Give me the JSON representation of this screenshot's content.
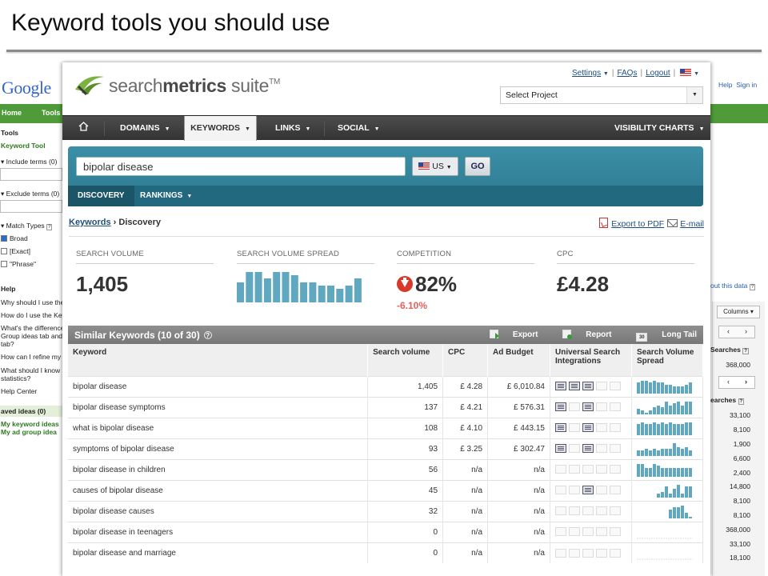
{
  "slide": {
    "title": "Keyword tools you should use"
  },
  "google_left": {
    "logo_text": "Google",
    "nav_home": "Home",
    "nav_tools": "Tools",
    "tools_heading": "Tools",
    "keyword_tool": "Keyword Tool",
    "include_terms": "Include terms (0)",
    "exclude_terms": "Exclude terms (0)",
    "match_types": "Match Types",
    "match_broad": "Broad",
    "match_exact": "[Exact]",
    "match_phrase": "\"Phrase\"",
    "help_heading": "Help",
    "help_lines": [
      "Why should I use the",
      "How do I use the Key",
      "What's the difference",
      "Group ideas tab and",
      "tab?",
      "How can I refine my i",
      "What should I know a",
      "statistics?",
      "Help Center"
    ],
    "saved_ideas": "aved ideas (0)",
    "my_keyword_ideas": "My keyword ideas",
    "my_ad_group_ideas": "My ad group idea"
  },
  "google_right": {
    "help": "Help",
    "sign_in": "Sign in",
    "about_data": "out this data",
    "columns": "Columns",
    "searches_label": "Searches",
    "searches_label2": "earches",
    "first_value": "368,000",
    "values": [
      "33,100",
      "8,100",
      "1,900",
      "6,600",
      "2,400",
      "14,800",
      "8,100",
      "8,100",
      "368,000",
      "33,100",
      "18,100"
    ]
  },
  "sm": {
    "brand_light": "search",
    "brand_bold": "metrics",
    "brand_suite": " suite",
    "brand_tm": "TM",
    "links": {
      "settings": "Settings",
      "faqs": "FAQs",
      "logout": "Logout"
    },
    "project_select": "Select Project",
    "nav": {
      "domains": "DOMAINS",
      "keywords": "KEYWORDS",
      "links": "LINKS",
      "social": "SOCIAL",
      "visibility_charts": "VISIBILITY CHARTS"
    },
    "search": {
      "value": "bipolar disease",
      "country": "US",
      "go": "GO"
    },
    "subtabs": {
      "discovery": "DISCOVERY",
      "rankings": "RANKINGS"
    },
    "breadcrumb": {
      "root": "Keywords",
      "sep": "›",
      "current": "Discovery"
    },
    "exports": {
      "pdf": "Export to PDF",
      "email": "E-mail"
    },
    "kpis": {
      "search_volume_label": "SEARCH VOLUME",
      "search_volume": "1,405",
      "spread_label": "SEARCH VOLUME SPREAD",
      "spread_values": [
        6,
        9,
        9,
        7,
        9,
        9,
        8,
        6,
        6,
        5,
        5,
        4,
        5,
        7
      ],
      "competition_label": "COMPETITION",
      "competition": "82%",
      "competition_change": "-6.10%",
      "cpc_label": "CPC",
      "cpc": "£4.28"
    },
    "similar": {
      "title": "Similar Keywords (10 of 30)",
      "export": "Export",
      "report": "Report",
      "long_tail": "Long Tail",
      "long_tail_badge": "30",
      "headers": [
        "Keyword",
        "Search volume",
        "CPC",
        "Ad Budget",
        "Universal Search Integrations",
        "Search Volume Spread"
      ],
      "rows": [
        {
          "keyword": "bipolar disease",
          "volume": "1,405",
          "cpc": "£ 4.28",
          "budget": "£ 6,010.84",
          "integrations": [
            1,
            1,
            1,
            0,
            0
          ],
          "spread": [
            6,
            7,
            7,
            6,
            7,
            6,
            6,
            5,
            5,
            4,
            4,
            4,
            5,
            6
          ]
        },
        {
          "keyword": "bipolar disease symptoms",
          "volume": "137",
          "cpc": "£ 4.21",
          "budget": "£ 576.31",
          "integrations": [
            1,
            0,
            1,
            0,
            0
          ],
          "spread": [
            3,
            2,
            1,
            2,
            4,
            5,
            4,
            7,
            5,
            6,
            7,
            5,
            7,
            7
          ]
        },
        {
          "keyword": "what is bipolar disease",
          "volume": "108",
          "cpc": "£ 4.10",
          "budget": "£ 443.15",
          "integrations": [
            1,
            0,
            1,
            0,
            0
          ],
          "spread": [
            6,
            7,
            6,
            6,
            7,
            6,
            7,
            6,
            7,
            6,
            6,
            6,
            7,
            7
          ]
        },
        {
          "keyword": "symptoms of bipolar disease",
          "volume": "93",
          "cpc": "£ 3.25",
          "budget": "£ 302.47",
          "integrations": [
            1,
            0,
            1,
            0,
            0
          ],
          "spread": [
            3,
            3,
            4,
            3,
            4,
            3,
            4,
            4,
            4,
            7,
            5,
            4,
            5,
            3
          ]
        },
        {
          "keyword": "bipolar disease in children",
          "volume": "56",
          "cpc": "n/a",
          "budget": "n/a",
          "integrations": [
            0,
            0,
            0,
            0,
            0
          ],
          "spread": [
            7,
            7,
            5,
            5,
            7,
            6,
            5,
            5,
            5,
            5,
            5,
            5,
            5,
            5
          ]
        },
        {
          "keyword": "causes of bipolar disease",
          "volume": "45",
          "cpc": "n/a",
          "budget": "n/a",
          "integrations": [
            0,
            0,
            1,
            0,
            0
          ],
          "spread": [
            0,
            0,
            0,
            0,
            0,
            2,
            3,
            6,
            2,
            5,
            7,
            2,
            6,
            6
          ]
        },
        {
          "keyword": "bipolar disease causes",
          "volume": "32",
          "cpc": "n/a",
          "budget": "n/a",
          "integrations": [
            0,
            0,
            0,
            0,
            0
          ],
          "spread": [
            0,
            0,
            0,
            0,
            0,
            0,
            0,
            0,
            5,
            6,
            6,
            7,
            3,
            1
          ]
        },
        {
          "keyword": "bipolar disease in teenagers",
          "volume": "0",
          "cpc": "n/a",
          "budget": "n/a",
          "integrations": [
            0,
            0,
            0,
            0,
            0
          ],
          "spread": [
            0,
            0,
            0,
            0,
            0,
            0,
            0,
            0,
            0,
            0,
            0,
            0,
            0,
            0
          ]
        },
        {
          "keyword": "bipolar disease and marriage",
          "volume": "0",
          "cpc": "n/a",
          "budget": "n/a",
          "integrations": [
            0,
            0,
            0,
            0,
            0
          ],
          "spread": [
            0,
            0,
            0,
            0,
            0,
            0,
            0,
            0,
            0,
            0,
            0,
            0,
            0,
            0
          ]
        }
      ]
    }
  },
  "colors": {
    "teal": "#3b8fa6",
    "spark": "#5fa8bf",
    "down": "#d63a2b",
    "google_green": "#4f9b3a"
  },
  "icons": [
    "home-icon",
    "flag-us-icon",
    "pdf-icon",
    "email-icon",
    "down-arrow-icon",
    "help-icon",
    "export-icon",
    "report-icon",
    "long-tail-icon"
  ]
}
